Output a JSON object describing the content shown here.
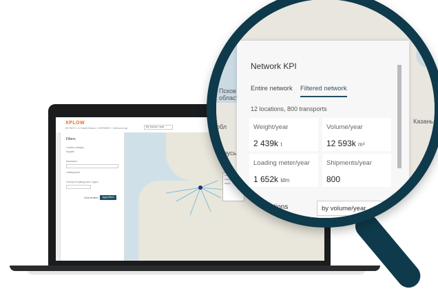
{
  "laptop": {
    "logo": "XPLOW",
    "breadcrumb": "DE PAYS > Il Cluster Milano > SHIPMENT > Network map",
    "select_value": "By Volume / year",
    "filters": {
      "title": "Filters",
      "rows": [
        "Location category",
        "Supplier",
        "Hazardous",
        "Loading point",
        "Country of loading point / region"
      ],
      "clear_label": "Clear all filters",
      "apply_label": "Apply filters"
    }
  },
  "kpi": {
    "title": "Network KPI",
    "tabs": [
      {
        "label": "Entire network",
        "active": false
      },
      {
        "label": "Filtered network",
        "active": true
      }
    ],
    "summary": "12 locations, 800 transports",
    "metrics": [
      {
        "label": "Weight/year",
        "value": "2 439k",
        "unit": "t"
      },
      {
        "label": "Volume/year",
        "value": "12 593k",
        "unit": "m³"
      },
      {
        "label": "Loading meter/year",
        "value": "1 652k",
        "unit": "ldm"
      },
      {
        "label": "Shipments/year",
        "value": "800",
        "unit": ""
      }
    ],
    "top_locations_label": "Top locations",
    "top_locations_select": "by volume/year"
  },
  "map_labels": [
    "Псков",
    "области",
    "Беларусь",
    "Казань",
    "обл"
  ],
  "colors": {
    "brand": "#e86b1d",
    "accent": "#1f4e64",
    "magnifier": "#0e3a4b"
  }
}
